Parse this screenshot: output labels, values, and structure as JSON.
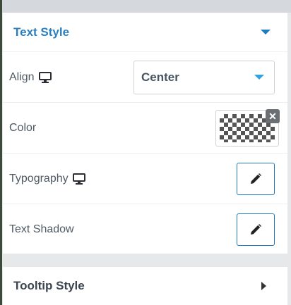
{
  "text_style": {
    "title": "Text Style",
    "align": {
      "label": "Align",
      "value": "Center"
    },
    "color": {
      "label": "Color",
      "clear_glyph": "✕"
    },
    "typography": {
      "label": "Typography"
    },
    "text_shadow": {
      "label": "Text Shadow"
    }
  },
  "tooltip_style": {
    "title": "Tooltip Style"
  },
  "colors": {
    "accent": "#1e7bbf",
    "title_blue": "#2a7fc0"
  }
}
